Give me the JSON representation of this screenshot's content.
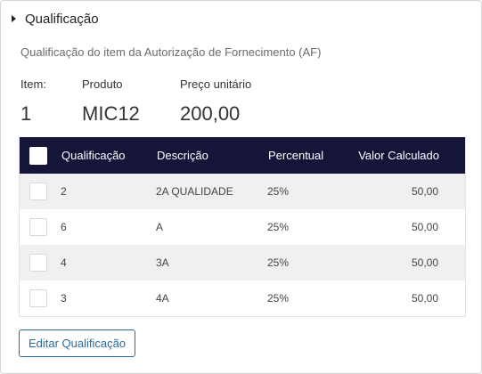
{
  "section": {
    "title": "Qualificação",
    "subtitle": "Qualificação do item da Autorização de Fornecimento (AF)"
  },
  "info": {
    "item_label": "Item:",
    "item_value": "1",
    "produto_label": "Produto",
    "produto_value": "MIC12",
    "preco_label": "Preço unitário",
    "preco_value": "200,00"
  },
  "table": {
    "headers": {
      "qualificacao": "Qualificação",
      "descricao": "Descrição",
      "percentual": "Percentual",
      "valor": "Valor Calculado"
    },
    "rows": [
      {
        "qualificacao": "2",
        "descricao": "2A QUALIDADE",
        "percentual": "25%",
        "valor": "50,00"
      },
      {
        "qualificacao": "6",
        "descricao": "A",
        "percentual": "25%",
        "valor": "50,00"
      },
      {
        "qualificacao": "4",
        "descricao": "3A",
        "percentual": "25%",
        "valor": "50,00"
      },
      {
        "qualificacao": "3",
        "descricao": "4A",
        "percentual": "25%",
        "valor": "50,00"
      }
    ]
  },
  "actions": {
    "edit_label": "Editar Qualificação"
  },
  "colors": {
    "header_bg": "#151439",
    "button_accent": "#2c6c9c"
  }
}
